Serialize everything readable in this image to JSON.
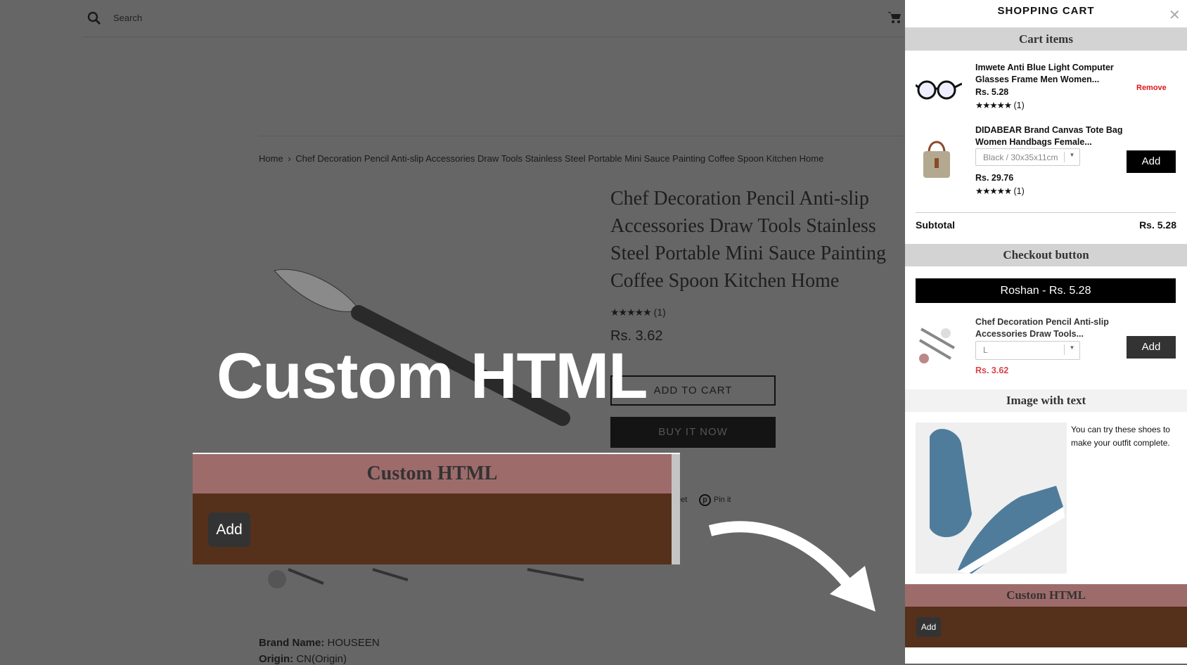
{
  "header": {
    "search_placeholder": "Search",
    "search_icon": "search-icon",
    "cart_icon": "cart-icon"
  },
  "breadcrumb": {
    "home": "Home",
    "separator": "›",
    "current": "Chef Decoration Pencil Anti-slip Accessories Draw Tools Stainless Steel Portable Mini Sauce Painting Coffee Spoon Kitchen Home"
  },
  "product": {
    "title": "Chef Decoration Pencil Anti-slip Accessories Draw Tools Stainless Steel Portable Mini Sauce Painting Coffee Spoon Kitchen Home",
    "stars": "★★★★★",
    "review_count": "(1)",
    "rating": 5,
    "price": "Rs. 3.62",
    "add_to_cart": "ADD TO CART",
    "buy_now": "BUY IT NOW",
    "tweet": "eet",
    "pin": "Pin it",
    "brand_label": "Brand Name:",
    "brand_value": "HOUSEEN",
    "origin_label": "Origin:",
    "origin_value": "CN(Origin)"
  },
  "overlay": {
    "big_text": "Custom HTML",
    "widget_title": "Custom HTML",
    "widget_button": "Add"
  },
  "cart": {
    "title": "SHOPPING CART",
    "sections": {
      "cart_items": "Cart items",
      "checkout": "Checkout button",
      "image_text": "Image with text",
      "custom_html": "Custom HTML"
    },
    "items": [
      {
        "title": "Imwete Anti Blue Light Computer Glasses Frame Men Women...",
        "price": "Rs. 5.28",
        "stars": "★★★★★",
        "reviews": "(1)",
        "action": "Remove"
      },
      {
        "title": "DIDABEAR Brand Canvas Tote Bag Women Handbags Female...",
        "variant": "Black / 30x35x11cm",
        "price": "Rs. 29.76",
        "stars": "★★★★★",
        "reviews": "(1)",
        "action": "Add"
      }
    ],
    "subtotal_label": "Subtotal",
    "subtotal_value": "Rs. 5.28",
    "checkout_label": "Roshan - Rs. 5.28",
    "upsell": {
      "title": "Chef Decoration Pencil Anti-slip Accessories Draw Tools...",
      "variant": "L",
      "price": "Rs. 3.62",
      "action": "Add"
    },
    "image_text": "You can try these shoes to make your outfit complete.",
    "custom_button": "Add"
  },
  "colors": {
    "overlay": "#666666",
    "custom_header": "#9e6b6b",
    "custom_body": "#55301a",
    "remove": "#e0141e",
    "upsell_price": "#d9434a"
  }
}
